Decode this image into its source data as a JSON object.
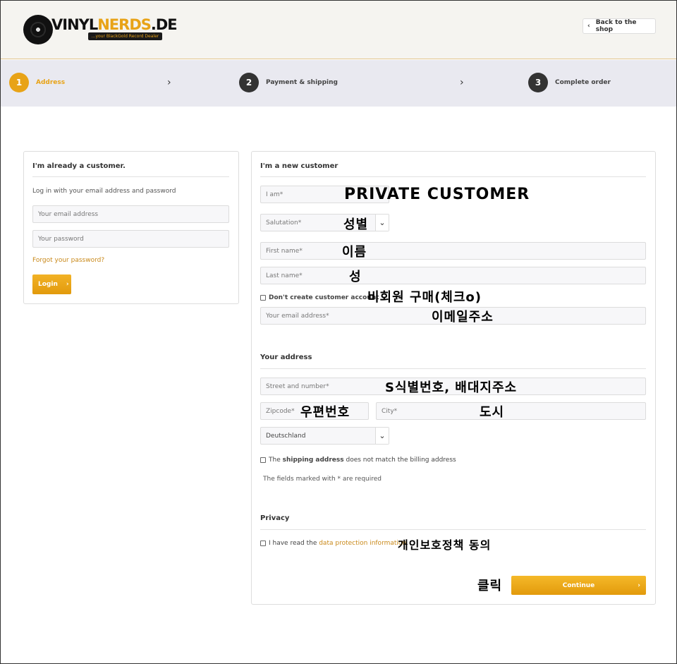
{
  "header": {
    "logo_main": "VINYL",
    "logo_accent": "NERDS",
    "logo_suffix": ".DE",
    "logo_tagline": "...your BlackGold Record Dealer",
    "back_label": "Back to the shop"
  },
  "steps": [
    {
      "num": "1",
      "label": "Address"
    },
    {
      "num": "2",
      "label": "Payment & shipping"
    },
    {
      "num": "3",
      "label": "Complete order"
    }
  ],
  "login": {
    "title": "I'm already a customer.",
    "intro": "Log in with your email address and password",
    "email_placeholder": "Your email address",
    "password_placeholder": "Your password",
    "forgot": "Forgot your password?",
    "button": "Login"
  },
  "register": {
    "title": "I'm a new customer",
    "iam_placeholder": "I am*",
    "salutation_placeholder": "Salutation*",
    "firstname_placeholder": "First name*",
    "lastname_placeholder": "Last name*",
    "no_account_label": "Don't create customer account",
    "email_placeholder": "Your email address*",
    "address_title": "Your address",
    "street_placeholder": "Street and number*",
    "zip_placeholder": "Zipcode*",
    "city_placeholder": "City*",
    "country_value": "Deutschland",
    "shipping_pre": "The ",
    "shipping_bold": "shipping address",
    "shipping_post": " does not match the billing address",
    "required_note": "The fields marked with * are required",
    "privacy_title": "Privacy",
    "privacy_pre": "I have read the ",
    "privacy_link": "data protection information",
    "privacy_post": ".",
    "continue_label": "Continue"
  },
  "annotations": {
    "iam": "PRIVATE CUSTOMER",
    "salutation": "성별",
    "firstname": "이름",
    "lastname": "성",
    "no_account": "비회원 구매(체크o)",
    "email": "이메일주소",
    "street": "S식별번호, 배대지주소",
    "zip": "우편번호",
    "city": "도시",
    "privacy": "개인보호정책 동의",
    "continue": "클릭"
  }
}
